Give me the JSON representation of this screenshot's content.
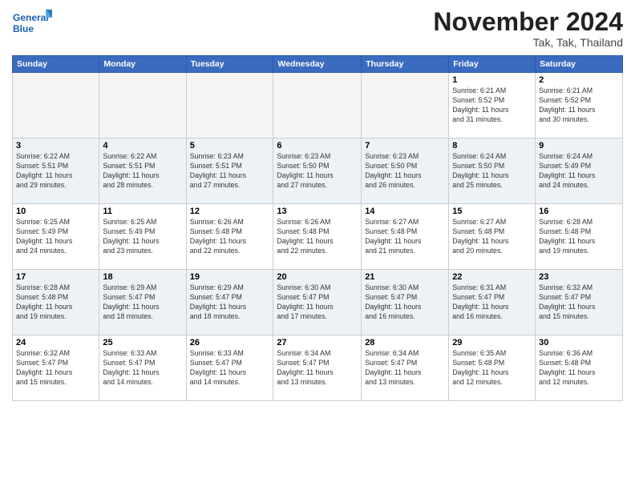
{
  "logo": {
    "text_general": "General",
    "text_blue": "Blue"
  },
  "header": {
    "month_title": "November 2024",
    "subtitle": "Tak, Tak, Thailand"
  },
  "weekdays": [
    "Sunday",
    "Monday",
    "Tuesday",
    "Wednesday",
    "Thursday",
    "Friday",
    "Saturday"
  ],
  "weeks": [
    [
      {
        "day": "",
        "info": ""
      },
      {
        "day": "",
        "info": ""
      },
      {
        "day": "",
        "info": ""
      },
      {
        "day": "",
        "info": ""
      },
      {
        "day": "",
        "info": ""
      },
      {
        "day": "1",
        "info": "Sunrise: 6:21 AM\nSunset: 5:52 PM\nDaylight: 11 hours\nand 31 minutes."
      },
      {
        "day": "2",
        "info": "Sunrise: 6:21 AM\nSunset: 5:52 PM\nDaylight: 11 hours\nand 30 minutes."
      }
    ],
    [
      {
        "day": "3",
        "info": "Sunrise: 6:22 AM\nSunset: 5:51 PM\nDaylight: 11 hours\nand 29 minutes."
      },
      {
        "day": "4",
        "info": "Sunrise: 6:22 AM\nSunset: 5:51 PM\nDaylight: 11 hours\nand 28 minutes."
      },
      {
        "day": "5",
        "info": "Sunrise: 6:23 AM\nSunset: 5:51 PM\nDaylight: 11 hours\nand 27 minutes."
      },
      {
        "day": "6",
        "info": "Sunrise: 6:23 AM\nSunset: 5:50 PM\nDaylight: 11 hours\nand 27 minutes."
      },
      {
        "day": "7",
        "info": "Sunrise: 6:23 AM\nSunset: 5:50 PM\nDaylight: 11 hours\nand 26 minutes."
      },
      {
        "day": "8",
        "info": "Sunrise: 6:24 AM\nSunset: 5:50 PM\nDaylight: 11 hours\nand 25 minutes."
      },
      {
        "day": "9",
        "info": "Sunrise: 6:24 AM\nSunset: 5:49 PM\nDaylight: 11 hours\nand 24 minutes."
      }
    ],
    [
      {
        "day": "10",
        "info": "Sunrise: 6:25 AM\nSunset: 5:49 PM\nDaylight: 11 hours\nand 24 minutes."
      },
      {
        "day": "11",
        "info": "Sunrise: 6:25 AM\nSunset: 5:49 PM\nDaylight: 11 hours\nand 23 minutes."
      },
      {
        "day": "12",
        "info": "Sunrise: 6:26 AM\nSunset: 5:48 PM\nDaylight: 11 hours\nand 22 minutes."
      },
      {
        "day": "13",
        "info": "Sunrise: 6:26 AM\nSunset: 5:48 PM\nDaylight: 11 hours\nand 22 minutes."
      },
      {
        "day": "14",
        "info": "Sunrise: 6:27 AM\nSunset: 5:48 PM\nDaylight: 11 hours\nand 21 minutes."
      },
      {
        "day": "15",
        "info": "Sunrise: 6:27 AM\nSunset: 5:48 PM\nDaylight: 11 hours\nand 20 minutes."
      },
      {
        "day": "16",
        "info": "Sunrise: 6:28 AM\nSunset: 5:48 PM\nDaylight: 11 hours\nand 19 minutes."
      }
    ],
    [
      {
        "day": "17",
        "info": "Sunrise: 6:28 AM\nSunset: 5:48 PM\nDaylight: 11 hours\nand 19 minutes."
      },
      {
        "day": "18",
        "info": "Sunrise: 6:29 AM\nSunset: 5:47 PM\nDaylight: 11 hours\nand 18 minutes."
      },
      {
        "day": "19",
        "info": "Sunrise: 6:29 AM\nSunset: 5:47 PM\nDaylight: 11 hours\nand 18 minutes."
      },
      {
        "day": "20",
        "info": "Sunrise: 6:30 AM\nSunset: 5:47 PM\nDaylight: 11 hours\nand 17 minutes."
      },
      {
        "day": "21",
        "info": "Sunrise: 6:30 AM\nSunset: 5:47 PM\nDaylight: 11 hours\nand 16 minutes."
      },
      {
        "day": "22",
        "info": "Sunrise: 6:31 AM\nSunset: 5:47 PM\nDaylight: 11 hours\nand 16 minutes."
      },
      {
        "day": "23",
        "info": "Sunrise: 6:32 AM\nSunset: 5:47 PM\nDaylight: 11 hours\nand 15 minutes."
      }
    ],
    [
      {
        "day": "24",
        "info": "Sunrise: 6:32 AM\nSunset: 5:47 PM\nDaylight: 11 hours\nand 15 minutes."
      },
      {
        "day": "25",
        "info": "Sunrise: 6:33 AM\nSunset: 5:47 PM\nDaylight: 11 hours\nand 14 minutes."
      },
      {
        "day": "26",
        "info": "Sunrise: 6:33 AM\nSunset: 5:47 PM\nDaylight: 11 hours\nand 14 minutes."
      },
      {
        "day": "27",
        "info": "Sunrise: 6:34 AM\nSunset: 5:47 PM\nDaylight: 11 hours\nand 13 minutes."
      },
      {
        "day": "28",
        "info": "Sunrise: 6:34 AM\nSunset: 5:47 PM\nDaylight: 11 hours\nand 13 minutes."
      },
      {
        "day": "29",
        "info": "Sunrise: 6:35 AM\nSunset: 5:48 PM\nDaylight: 11 hours\nand 12 minutes."
      },
      {
        "day": "30",
        "info": "Sunrise: 6:36 AM\nSunset: 5:48 PM\nDaylight: 11 hours\nand 12 minutes."
      }
    ]
  ]
}
